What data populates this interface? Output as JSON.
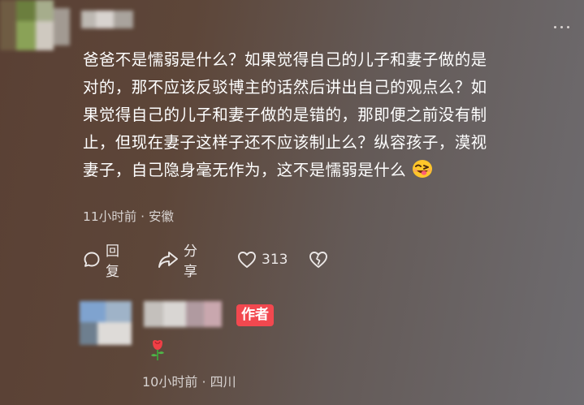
{
  "comment": {
    "lines": [
      "爸爸不是懦弱是什么？如果觉得自己的儿子和妻子做的是",
      "对的，那不应该反驳博主的话然后讲出自己的观点么？如",
      "果觉得自己的儿子和妻子做的是错的，那即便之前没有制",
      "止，但现在妻子这样子还不应该制止么？纵容孩子，漠视",
      "妻子，自己隐身毫无作为，这不是懦弱是什么"
    ],
    "emoji": "wink-tongue-emoji",
    "time": "11小时前",
    "separator": "·",
    "location": "安徽"
  },
  "actions": {
    "reply_label": "回复",
    "share_label": "分享",
    "like_count": "313"
  },
  "reply": {
    "author_badge": "作者",
    "content_icon": "rose-emoji",
    "time": "10小时前",
    "separator": "·",
    "location": "四川"
  },
  "colors": {
    "badge": "#f2484f",
    "text": "#ffffff",
    "meta": "#d7d2d0"
  }
}
